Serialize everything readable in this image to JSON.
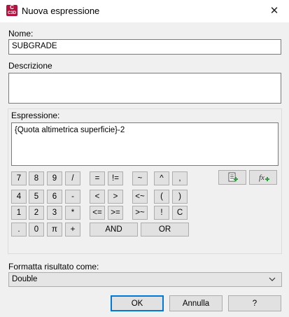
{
  "window": {
    "title": "Nuova espressione",
    "app_icon": "civil-3d-app-icon",
    "close_label": "✕"
  },
  "name": {
    "label": "Nome:",
    "value": "SUBGRADE"
  },
  "description": {
    "label": "Descrizione",
    "value": ""
  },
  "expression": {
    "label": "Espressione:",
    "value": "{Quota altimetrica superficie}-2"
  },
  "keypad": {
    "row1": [
      "7",
      "8",
      "9",
      "/",
      "=",
      "!=",
      "~",
      "^",
      ","
    ],
    "row2": [
      "4",
      "5",
      "6",
      "-",
      "<",
      ">",
      "<~",
      "(",
      ")"
    ],
    "row3": [
      "1",
      "2",
      "3",
      "*",
      "<=",
      ">=",
      ">~",
      "!",
      "C"
    ],
    "row4": [
      ".",
      "0",
      "π",
      "+",
      "AND",
      "OR"
    ]
  },
  "tools": {
    "insert_property_icon": "insert-property-icon",
    "insert_function_icon": "insert-function-icon"
  },
  "format": {
    "label": "Formatta risultato come:",
    "value": "Double"
  },
  "buttons": {
    "ok": "OK",
    "cancel": "Annulla",
    "help": "?"
  }
}
